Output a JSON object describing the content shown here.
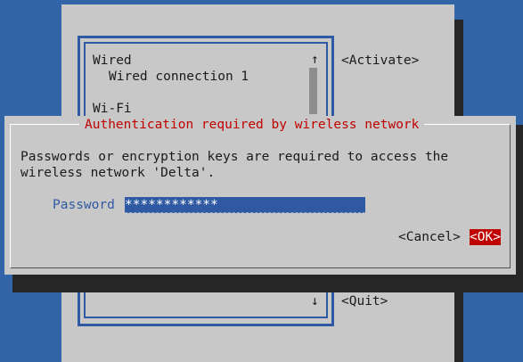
{
  "background": {
    "list": {
      "items": [
        {
          "label": "Wired",
          "indent": false
        },
        {
          "label": "Wired connection 1",
          "indent": true
        },
        {
          "label": "Wi-Fi",
          "indent": false
        }
      ],
      "scroll_up": "↑",
      "scroll_down": "↓"
    },
    "buttons": {
      "activate": "<Activate>",
      "quit": "<Quit>"
    }
  },
  "dialog": {
    "title": "Authentication required by wireless network",
    "message_line1": "Passwords or encryption keys are required to access the",
    "message_line2": "wireless network 'Delta'.",
    "password_label": "Password",
    "password_value": "************",
    "cancel_label": "<Cancel>",
    "ok_label": "<OK>"
  },
  "colors": {
    "desktop": "#3264a8",
    "panel": "#c8c8c8",
    "title_text": "#c00000",
    "accent": "#2f5aa3",
    "ok_bg": "#c00000"
  }
}
